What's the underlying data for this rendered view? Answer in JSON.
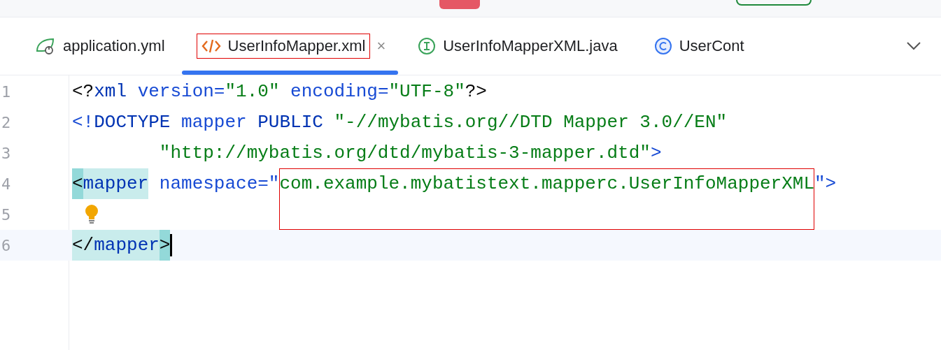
{
  "top_bar": {
    "marks": [
      {
        "kind": "red-pill"
      },
      {
        "kind": "green-pill"
      }
    ]
  },
  "tabs": [
    {
      "label": "application.yml",
      "kind": "spring",
      "selected": false,
      "annotated": false
    },
    {
      "label": "UserInfoMapper.xml",
      "kind": "xml",
      "selected": true,
      "annotated": true,
      "close_label": "×"
    },
    {
      "label": "UserInfoMapperXML.java",
      "kind": "interface",
      "selected": false,
      "annotated": false
    },
    {
      "label": "UserCont",
      "kind": "class",
      "selected": false,
      "annotated": false
    }
  ],
  "editor": {
    "lines": [
      {
        "number": "1",
        "current": false,
        "tokens": [
          {
            "t": "<?",
            "kind": "punct"
          },
          {
            "t": "xml ",
            "kind": "tag"
          },
          {
            "t": "version=",
            "kind": "attr"
          },
          {
            "t": "\"1.0\"",
            "kind": "value"
          },
          {
            "t": " encoding=",
            "kind": "attr"
          },
          {
            "t": "\"UTF-8\"",
            "kind": "value"
          },
          {
            "t": "?>",
            "kind": "punct"
          }
        ]
      },
      {
        "number": "2",
        "current": false,
        "tokens": [
          {
            "t": "<!",
            "kind": "attr"
          },
          {
            "t": "DOCTYPE ",
            "kind": "tag"
          },
          {
            "t": "mapper ",
            "kind": "attr"
          },
          {
            "t": "PUBLIC ",
            "kind": "tag"
          },
          {
            "t": "\"-//mybatis.org//DTD Mapper 3.0//EN\"",
            "kind": "value"
          }
        ]
      },
      {
        "number": "3",
        "current": false,
        "indented": true,
        "tokens": [
          {
            "t": "\"http://mybatis.org/dtd/mybatis-3-mapper.dtd\"",
            "kind": "value"
          },
          {
            "t": ">",
            "kind": "attr"
          }
        ]
      },
      {
        "number": "4",
        "current": false,
        "tokens": [
          {
            "t": "<",
            "kind": "punct",
            "bracket_match": true
          },
          {
            "t": "mapper",
            "kind": "tag",
            "tag_match": true
          },
          {
            "t": " namespace=\"",
            "kind": "attr"
          },
          {
            "t": "com.example.mybatistext.mapperc.UserInfoMapperXML",
            "kind": "value",
            "annotated": true
          },
          {
            "t": "\">",
            "kind": "attr"
          }
        ]
      },
      {
        "number": "5",
        "current": false,
        "bulb": true
      },
      {
        "number": "6",
        "current": true,
        "cursor": true,
        "tokens": [
          {
            "t": "</",
            "kind": "punct",
            "tag_match": true
          },
          {
            "t": "mapper",
            "kind": "tag",
            "tag_match": true
          },
          {
            "t": ">",
            "kind": "punct",
            "bracket_match": true
          }
        ]
      }
    ]
  }
}
